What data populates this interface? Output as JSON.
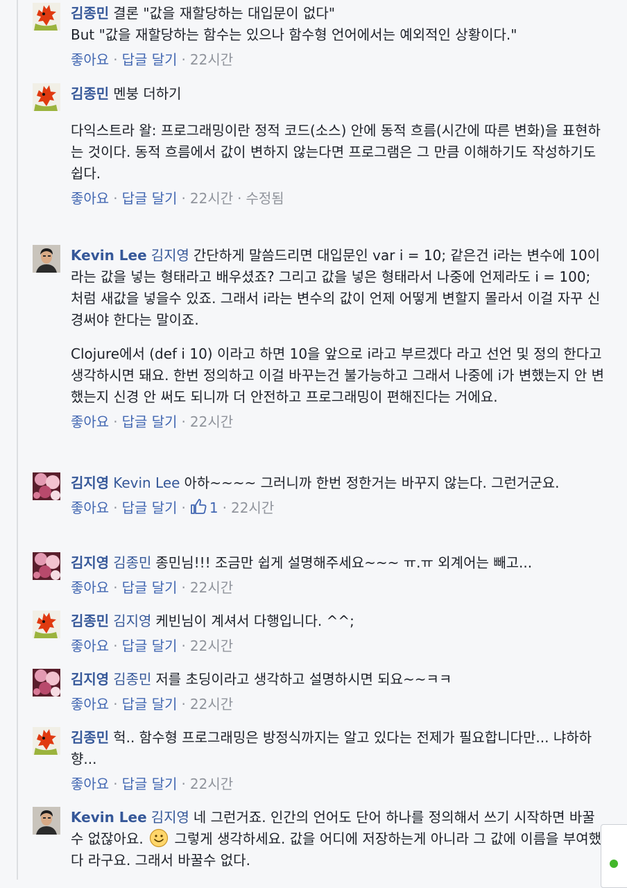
{
  "actions": {
    "like": "좋아요",
    "reply": "답글 달기",
    "sep": "·",
    "edited": "수정됨"
  },
  "colors": {
    "link": "#365899",
    "action": "#4267b2",
    "meta": "#90949c",
    "online": "#42b72a"
  },
  "icons": {
    "avatar_jongmin": "red-frog-avatar",
    "avatar_kevin": "man-portrait-avatar",
    "avatar_jiyoung": "pink-flower-avatar",
    "like": "thumbs-up-icon",
    "emoticon": "smile-emoticon-icon"
  },
  "comments": [
    {
      "author": "김종민",
      "text1": "결론 \"값을 재할당하는 대입문이 없다\"",
      "text2": "But \"값을 재할당하는 함수는 있으나 함수형 언어에서는 예외적인 상황이다.\"",
      "time": "22시간"
    },
    {
      "author": "김종민",
      "text1": "멘붕 더하기",
      "text2": "다익스트라 왈: 프로그래밍이란 정적 코드(소스) 안에 동적 흐름(시간에 따른 변화)을 표현하는 것이다. 동적 흐름에서 값이 변하지 않는다면 프로그램은 그 만큼 이해하기도 작성하기도 쉽다.",
      "time": "22시간"
    },
    {
      "author": "Kevin Lee",
      "mention": "김지영",
      "text1": "간단하게 말씀드리면 대입문인 var i = 10; 같은건 i라는 변수에 10이라는 값을 넣는 형태라고 배우셨죠? 그리고 값을 넣은 형태라서 나중에 언제라도 i = 100; 처럼 새값을 넣을수 있죠. 그래서 i라는 변수의 값이 언제 어떻게 변할지 몰라서 이걸 자꾸 신경써야 한다는 말이죠.",
      "text2": "Clojure에서 (def i 10) 이라고 하면 10을 앞으로 i라고 부르겠다 라고 선언 및 정의 한다고 생각하시면 돼요. 한번 정의하고 이걸 바꾸는건 불가능하고 그래서 나중에 i가 변했는지 안 변했는지 신경 안 써도 되니까 더 안전하고 프로그래밍이 편해진다는 거에요.",
      "time": "22시간"
    },
    {
      "author": "김지영",
      "mention": "Kevin Lee",
      "text1": "아하~~~~ 그러니까 한번 정한거는 바꾸지 않는다. 그런거군요.",
      "likes": "1",
      "time": "22시간"
    },
    {
      "author": "김지영",
      "mention": "김종민",
      "text1": "종민님!!! 조금만 쉽게 설명해주세요~~~ ㅠ.ㅠ 외계어는 빼고...",
      "time": "22시간"
    },
    {
      "author": "김종민",
      "mention": "김지영",
      "text1": "케빈님이 계셔서 다행입니다. ^^;",
      "time": "22시간"
    },
    {
      "author": "김지영",
      "mention": "김종민",
      "text1": "저를 초딩이라고 생각하고 설명하시면 되요~~ㅋㅋ",
      "time": "22시간"
    },
    {
      "author": "김종민",
      "text1": "헉.. 함수형 프로그래밍은 방정식까지는 알고 있다는 전제가 필요합니다만... 냐하하향...",
      "time": "22시간"
    },
    {
      "author": "Kevin Lee",
      "mention": "김지영",
      "text1": "네 그런거죠. 인간의 언어도 단어 하나를 정의해서 쓰기 시작하면 바꿀수 없잖아요.",
      "text2": "그렇게 생각하세요. 값을 어디에 저장하는게 아니라 그 값에 이름을 부여했다 라구요. 그래서 바꿀수 없다."
    }
  ]
}
